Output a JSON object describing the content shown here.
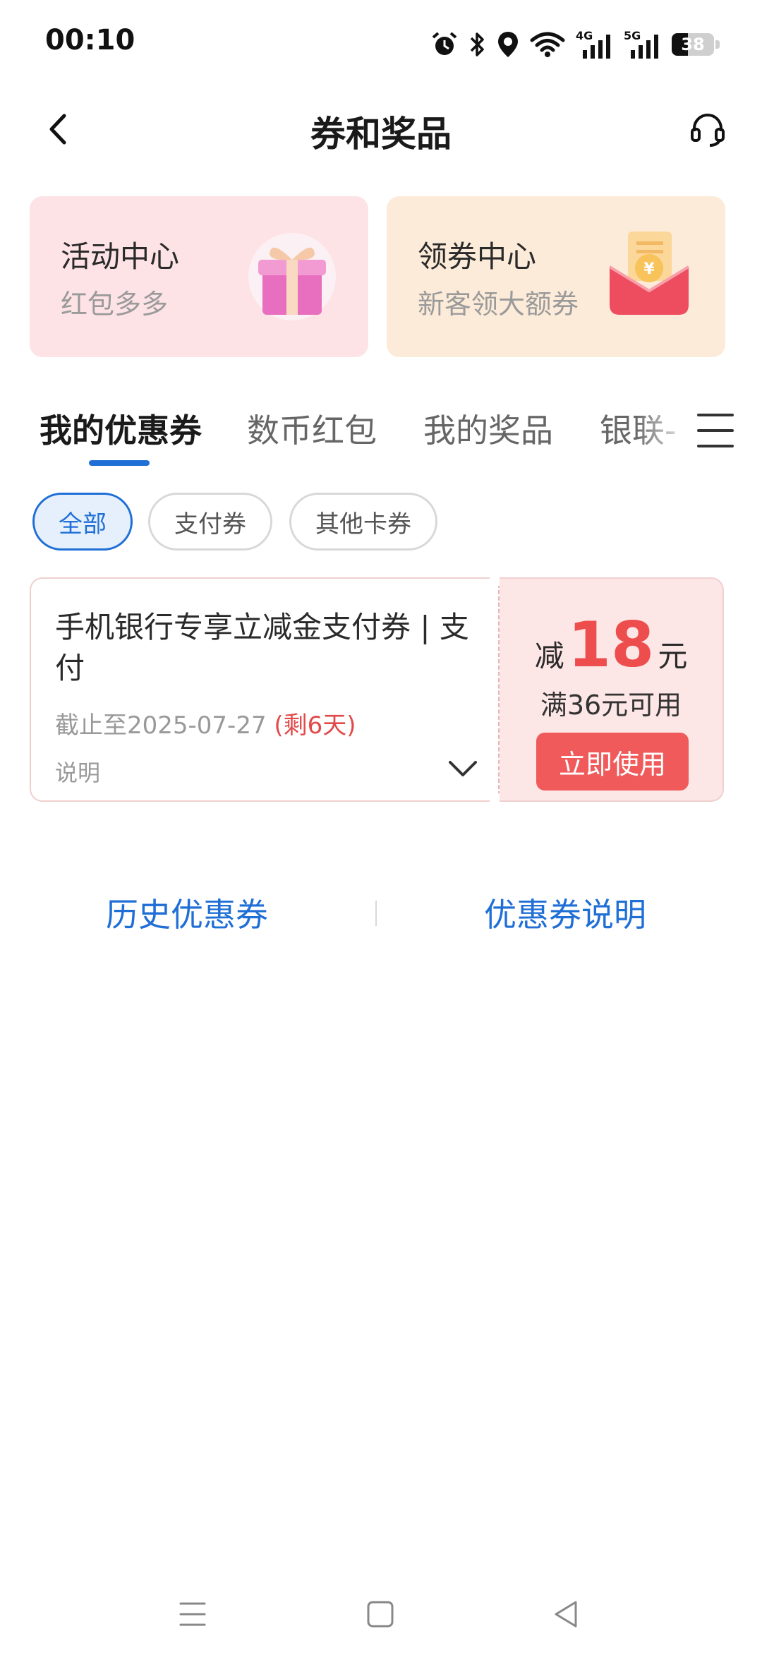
{
  "status_bar": {
    "time": "00:10",
    "battery_level": "38",
    "network_labels": [
      "4G",
      "5G"
    ],
    "icons": [
      "alarm-icon",
      "bluetooth-icon",
      "location-icon",
      "wifi-icon",
      "signal-4g-icon",
      "signal-5g-icon",
      "battery-icon"
    ]
  },
  "header": {
    "title": "券和奖品",
    "back_icon": "chevron-left-icon",
    "service_icon": "headset-icon"
  },
  "promo_cards": [
    {
      "title": "活动中心",
      "subtitle": "红包多多",
      "icon": "gift-box-icon",
      "bg": "#fde3e6"
    },
    {
      "title": "领券中心",
      "subtitle": "新客领大额券",
      "icon": "red-envelope-icon",
      "bg": "#fdebd9"
    }
  ],
  "tabs": [
    {
      "label": "我的优惠券",
      "active": true
    },
    {
      "label": "数币红包",
      "active": false
    },
    {
      "label": "我的奖品",
      "active": false
    },
    {
      "label": "银联-",
      "active": false
    }
  ],
  "filters": [
    {
      "label": "全部",
      "active": true
    },
    {
      "label": "支付券",
      "active": false
    },
    {
      "label": "其他卡券",
      "active": false
    }
  ],
  "coupon": {
    "title": "手机银行专享立减金支付券 | 支付",
    "expiry": "截止至2025-07-27",
    "remaining": "(剩6天)",
    "note_label": "说明",
    "amount_prefix": "减",
    "amount": "18",
    "amount_unit": "元",
    "threshold": "满36元可用",
    "action": "立即使用"
  },
  "links": {
    "history": "历史优惠券",
    "explain": "优惠券说明"
  },
  "colors": {
    "accent": "#1f6fd6",
    "coupon_red": "#ee4d4d",
    "button_red": "#f05a5a"
  }
}
